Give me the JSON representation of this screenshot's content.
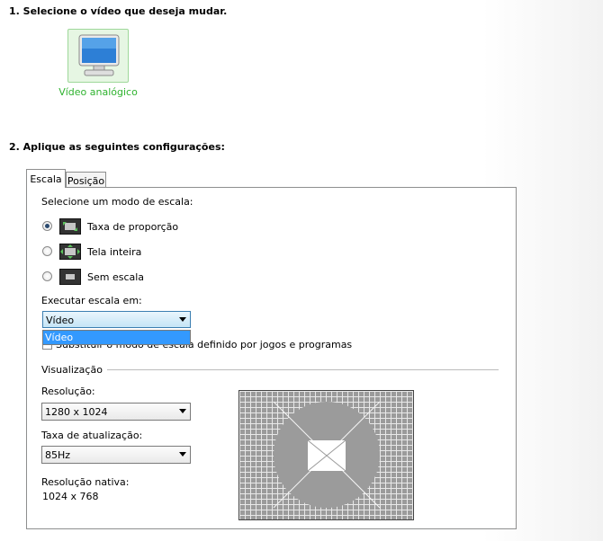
{
  "step1": {
    "title": "1. Selecione o vídeo que deseja mudar."
  },
  "video": {
    "label": "Vídeo analógico",
    "icon": "monitor-icon"
  },
  "step2": {
    "title": "2. Aplique as seguintes configurações:"
  },
  "tabs": [
    {
      "label": "Escala",
      "active": true
    },
    {
      "label": "Posição",
      "active": false
    }
  ],
  "scaling": {
    "heading": "Selecione um modo de escala:",
    "options": [
      {
        "label": "Taxa de proporção",
        "selected": true,
        "icon": "aspect-ratio-icon"
      },
      {
        "label": "Tela inteira",
        "selected": false,
        "icon": "full-screen-icon"
      },
      {
        "label": "Sem escala",
        "selected": false,
        "icon": "no-scaling-icon"
      }
    ]
  },
  "perform": {
    "label": "Executar escala em:",
    "value": "Vídeo",
    "dropdown_options": [
      "Vídeo"
    ]
  },
  "override": {
    "label": "Substituir o modo de escala definido por jogos e programas",
    "checked": false
  },
  "visualization": {
    "title": "Visualização",
    "resolution_label": "Resolução:",
    "resolution_value": "1280 x 1024",
    "refresh_label": "Taxa de atualização:",
    "refresh_value": "85Hz",
    "native_label": "Resolução nativa:",
    "native_value": "1024 x 768"
  },
  "colors": {
    "accent_green": "#2fb32f",
    "selection_blue": "#3399ff"
  }
}
